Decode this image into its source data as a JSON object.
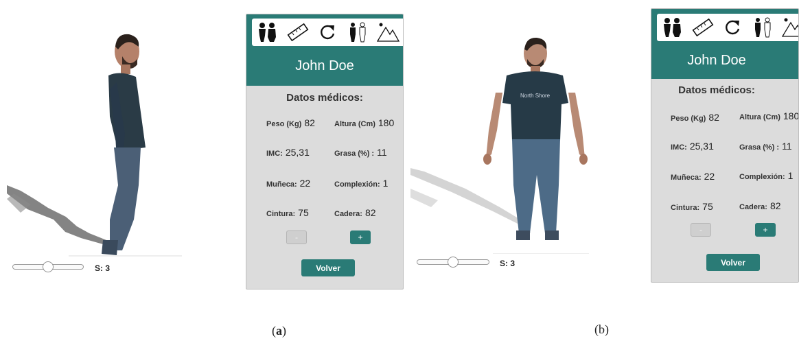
{
  "panels": [
    {
      "user_name": "John Doe",
      "section_title": "Datos médicos:",
      "fields": [
        {
          "label": "Peso (Kg)",
          "value": "82"
        },
        {
          "label": "Altura (Cm)",
          "value": "180"
        },
        {
          "label": "IMC:",
          "value": "25,31"
        },
        {
          "label": "Grasa (%) :",
          "value": "11"
        },
        {
          "label": "Muñeca:",
          "value": "22"
        },
        {
          "label": "Complexión:",
          "value": "1"
        },
        {
          "label": "Cintura:",
          "value": "75"
        },
        {
          "label": "Cadera:",
          "value": "82"
        }
      ],
      "minus_label": "-",
      "plus_label": "+",
      "back_label": "Volver",
      "slider_label": "S: 3",
      "slider_value": 0.4
    },
    {
      "user_name": "John Doe",
      "section_title": "Datos médicos:",
      "fields": [
        {
          "label": "Peso (Kg)",
          "value": "82"
        },
        {
          "label": "Altura (Cm)",
          "value": "180"
        },
        {
          "label": "IMC:",
          "value": "25,31"
        },
        {
          "label": "Grasa (%) :",
          "value": "11"
        },
        {
          "label": "Muñeca:",
          "value": "22"
        },
        {
          "label": "Complexión:",
          "value": "1"
        },
        {
          "label": "Cintura:",
          "value": "75"
        },
        {
          "label": "Cadera:",
          "value": "82"
        }
      ],
      "minus_label": "-",
      "plus_label": "+",
      "back_label": "Volver",
      "slider_label": "S: 3",
      "slider_value": 0.4
    }
  ],
  "toolbar_icons": [
    "people-icon",
    "ruler-icon",
    "rotate-icon",
    "body-outline-icon",
    "mountain-icon"
  ],
  "captions": [
    "a",
    "b"
  ],
  "colors": {
    "accent": "#2a7b76",
    "panel_bg": "#dcdcdc"
  }
}
